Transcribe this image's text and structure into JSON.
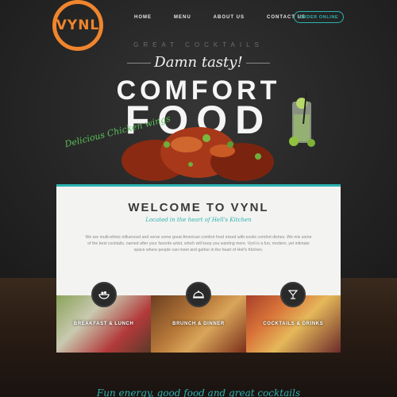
{
  "logo": {
    "text": "VYNL",
    "color": "#f0852d"
  },
  "nav": {
    "items": [
      "HOME",
      "MENU",
      "ABOUT US",
      "CONTACT US"
    ],
    "order_button": "ORDER ONLINE"
  },
  "hero": {
    "tagline": "GREAT COCKTAILS",
    "script": "Damn tasty!",
    "line1": "COMFORT",
    "line2": "FOOD",
    "callout": "Delicious Chicken wings"
  },
  "welcome": {
    "title": "WELCOME TO VYNL",
    "subtitle": "Located in the heart of Hell's Kitchen",
    "body": "We are multi-ethnic influenced and serve some great American comfort food mixed with exotic comfort dishes. We mix some of the best cocktails, named after your favorite artist, which will keep you wanting more. Vynl is a fun, modern, yet intimate space where people can meet and gather in the heart of Hell's Kitchen."
  },
  "cards": [
    {
      "label": "BREAKFAST & LUNCH",
      "icon": "salad-icon"
    },
    {
      "label": "BRUNCH & DINNER",
      "icon": "cloche-icon"
    },
    {
      "label": "COCKTAILS & DRINKS",
      "icon": "cocktail-icon"
    }
  ],
  "footer": {
    "script": "Fun energy, good food and great cocktails"
  },
  "colors": {
    "accent": "#2bb3b1",
    "brand": "#f0852d",
    "callout": "#5bc05a"
  }
}
